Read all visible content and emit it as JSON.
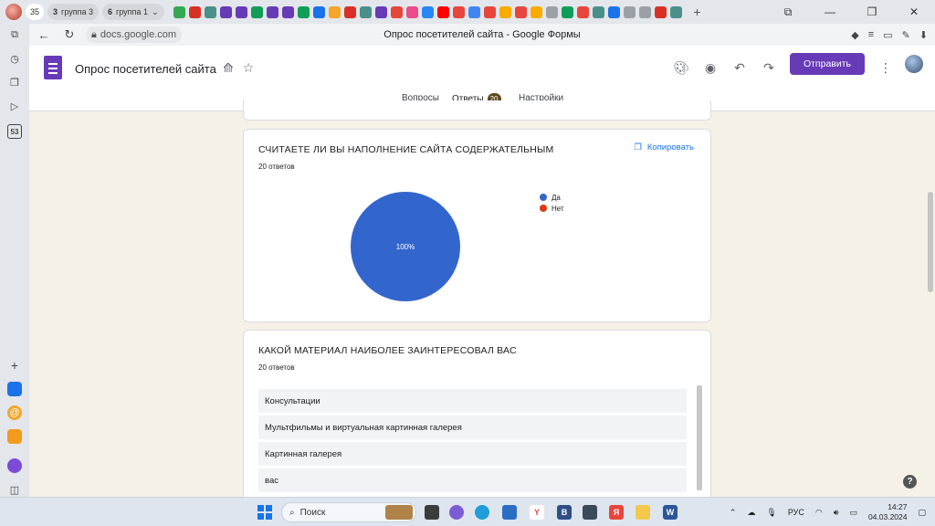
{
  "browser": {
    "tab_count": "35",
    "tab_groups": [
      {
        "count": "3",
        "label": "группа 3"
      },
      {
        "count": "6",
        "label": "группа 1"
      }
    ],
    "url": "docs.google.com",
    "page_title": "Опрос посетителей сайта - Google Формы",
    "sidebar_badge": "53"
  },
  "form": {
    "title": "Опрос посетителей сайта",
    "send_label": "Отправить",
    "tabs": [
      {
        "label": "Вопросы"
      },
      {
        "label": "Ответы",
        "count": "20"
      },
      {
        "label": "Настройки"
      }
    ],
    "accent_color": "#673ab7"
  },
  "questions": [
    {
      "title": "СЧИТАЕТЕ ЛИ ВЫ НАПОЛНЕНИЕ САЙТА СОДЕРЖАТЕЛЬНЫМ",
      "responses": "20 ответов",
      "copy_label": "Копировать",
      "chart_data": {
        "type": "pie",
        "categories": [
          "Да",
          "Нет"
        ],
        "values": [
          20,
          0
        ],
        "colors": [
          "#3366cc",
          "#dc3912"
        ],
        "slice_label": "100%",
        "legend_position": "right"
      }
    },
    {
      "title": "КАКОЙ МАТЕРИАЛ НАИБОЛЕЕ ЗАИНТЕРЕСОВАЛ ВАС",
      "responses": "20 ответов",
      "answers": [
        "Консультации",
        "Мультфильмы и виртуальная картинная галерея",
        "Картинная галерея",
        "вас"
      ]
    }
  ],
  "taskbar": {
    "search_placeholder": "Поиск",
    "language": "РУС",
    "time": "14:27",
    "date": "04.03.2024"
  }
}
